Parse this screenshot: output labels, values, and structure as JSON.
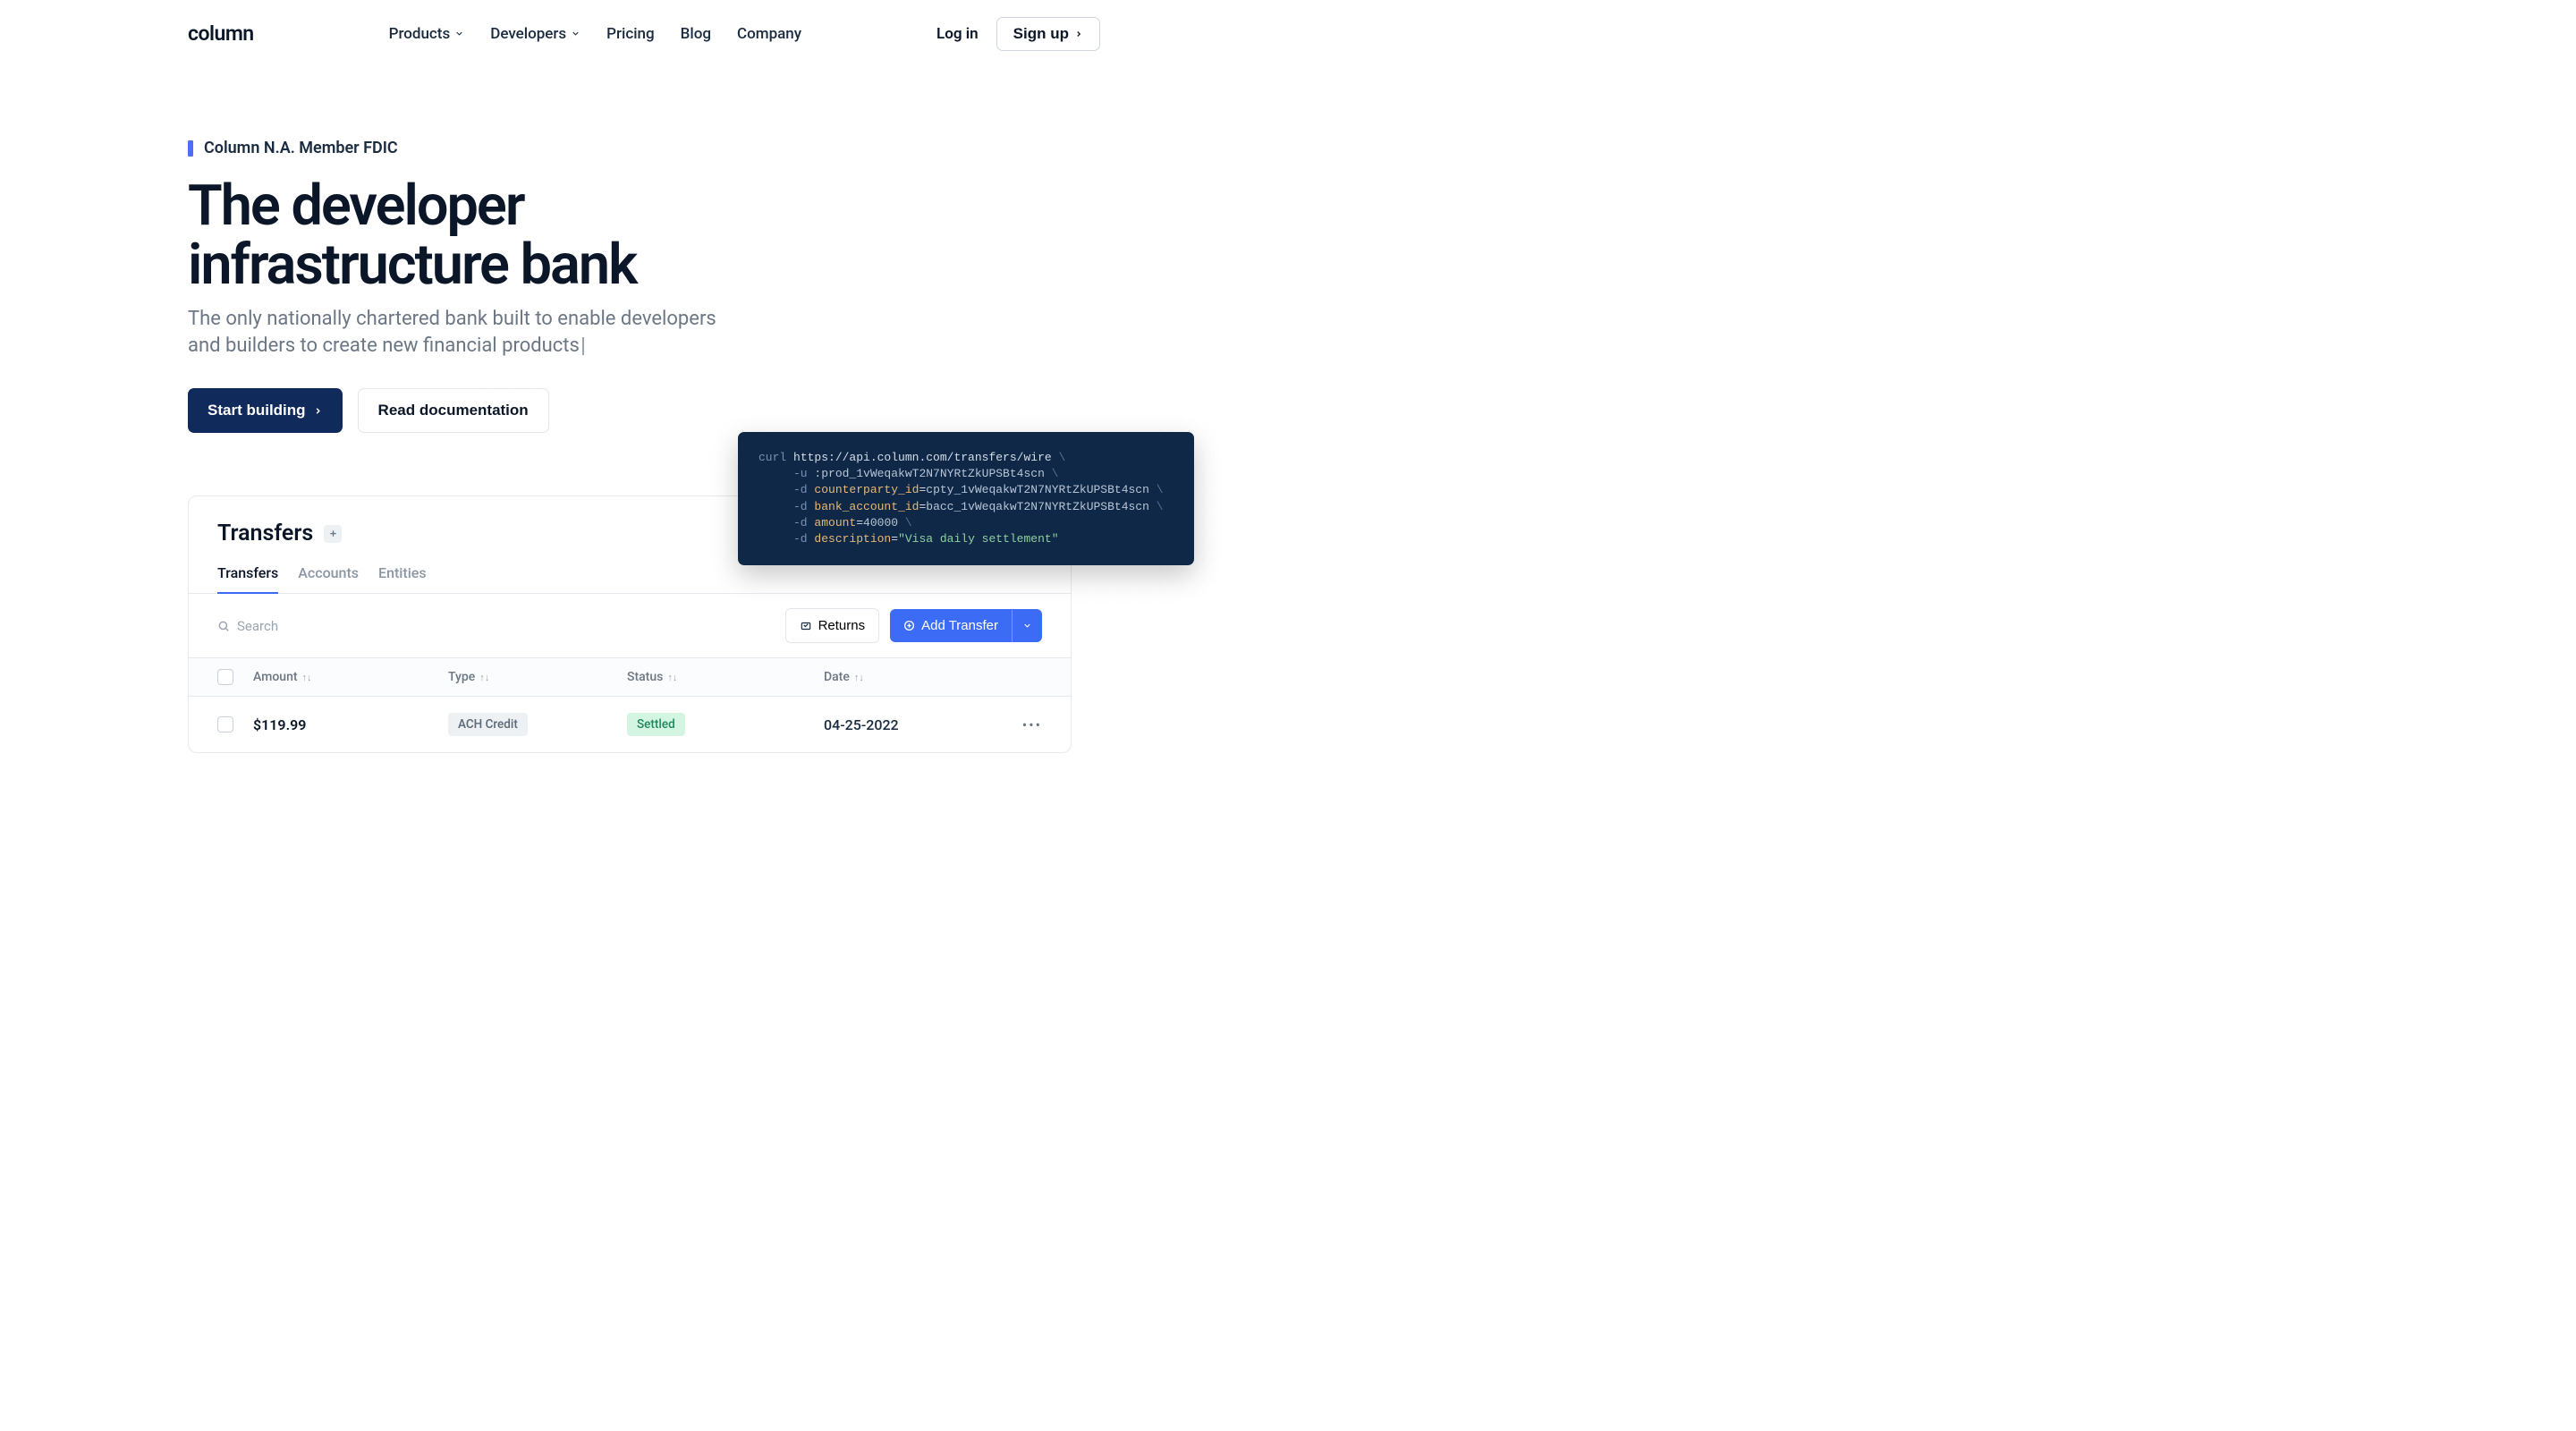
{
  "brand": "column",
  "nav": {
    "products": "Products",
    "developers": "Developers",
    "pricing": "Pricing",
    "blog": "Blog",
    "company": "Company"
  },
  "auth": {
    "login": "Log in",
    "signup": "Sign up"
  },
  "hero": {
    "badge": "Column N.A. Member FDIC",
    "title_line1": "The developer",
    "title_line2": "infrastructure bank",
    "subtitle": "The only nationally chartered bank built to enable developers and builders to create new financial products",
    "cta_primary": "Start building",
    "cta_secondary": "Read documentation"
  },
  "code": {
    "l1a": "curl",
    "l1b": " https://api.column.com/transfers/wire ",
    "l2a": "     -u ",
    "l2b": ":prod_1vWeqakwT2N7NYRtZkUPSBt4scn ",
    "l3a": "     -d ",
    "l3b": "counterparty_id",
    "l3c": "=",
    "l3d": "cpty_1vWeqakwT2N7NYRtZkUPSBt4scn ",
    "l4a": "     -d ",
    "l4b": "bank_account_id",
    "l4c": "=",
    "l4d": "bacc_1vWeqakwT2N7NYRtZkUPSBt4scn ",
    "l5a": "     -d ",
    "l5b": "amount",
    "l5c": "=",
    "l5d": "40000 ",
    "l6a": "     -d ",
    "l6b": "description",
    "l6c": "=",
    "l6d": "\"Visa daily settlement\""
  },
  "panel": {
    "title": "Transfers",
    "tabs": [
      "Transfers",
      "Accounts",
      "Entities"
    ],
    "search_placeholder": "Search",
    "returns": "Returns",
    "add": "Add Transfer",
    "columns": {
      "amount": "Amount",
      "type": "Type",
      "status": "Status",
      "date": "Date"
    },
    "row1": {
      "amount": "$119.99",
      "type": "ACH Credit",
      "status": "Settled",
      "date": "04-25-2022"
    }
  }
}
